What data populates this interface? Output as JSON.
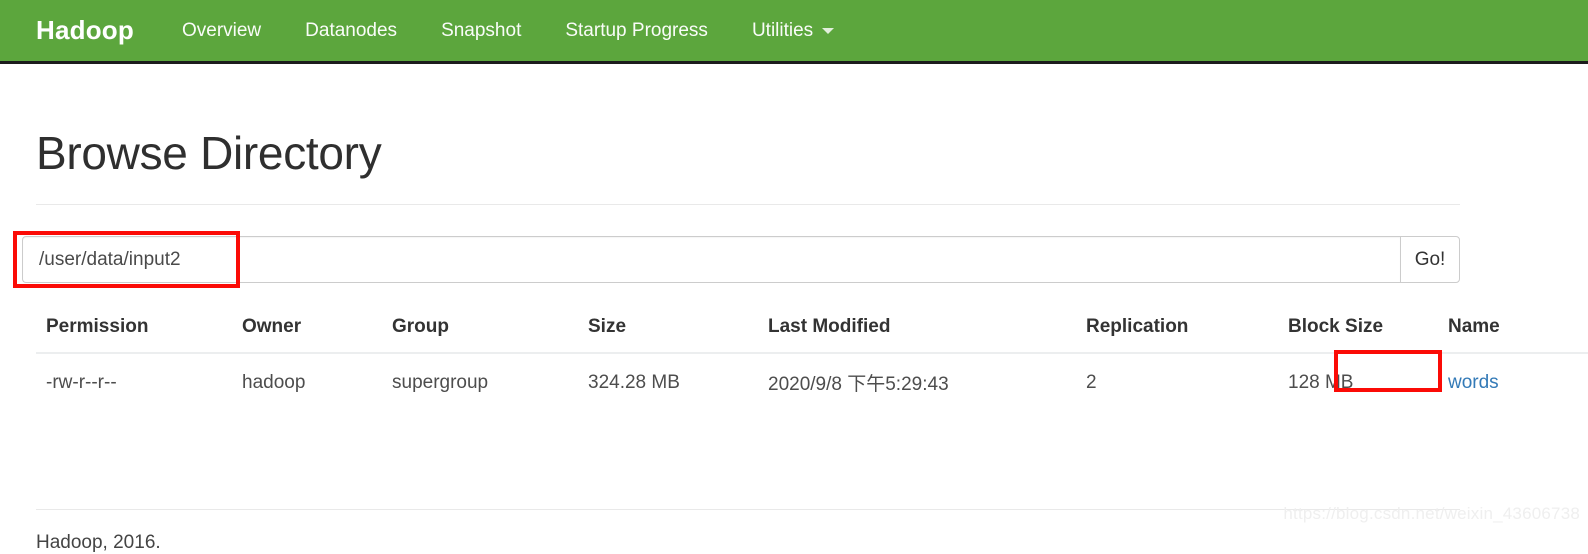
{
  "navbar": {
    "brand": "Hadoop",
    "links": [
      {
        "label": "Overview"
      },
      {
        "label": "Datanodes"
      },
      {
        "label": "Snapshot"
      },
      {
        "label": "Startup Progress"
      }
    ],
    "dropdown": {
      "label": "Utilities",
      "caret_icon": "chevron-down-icon"
    },
    "background_color": "#5ca63d"
  },
  "main": {
    "title": "Browse Directory"
  },
  "path_bar": {
    "value": "/user/data/input2",
    "placeholder": "Enter a path",
    "go_label": "Go!"
  },
  "table": {
    "headers": [
      "Permission",
      "Owner",
      "Group",
      "Size",
      "Last Modified",
      "Replication",
      "Block Size",
      "Name"
    ],
    "rows": [
      {
        "permission": "-rw-r--r--",
        "owner": "hadoop",
        "group": "supergroup",
        "size": "324.28 MB",
        "last_modified": "2020/9/8 下午5:29:43",
        "replication": "2",
        "block_size": "128 MB",
        "name": "words"
      }
    ]
  },
  "footer": {
    "text": "Hadoop, 2016."
  },
  "watermark": {
    "text": "https://blog.csdn.net/weixin_43606738"
  },
  "annotations": {
    "highlight_color": "#fb0b06",
    "boxes": [
      {
        "target": "path-input"
      },
      {
        "target": "name-link-words"
      }
    ]
  }
}
